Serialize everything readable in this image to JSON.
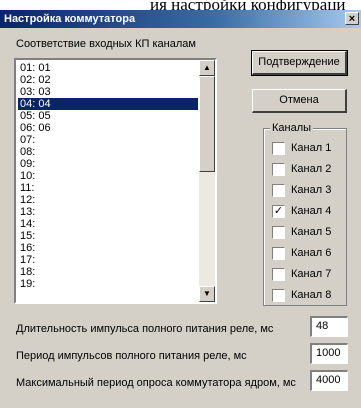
{
  "window": {
    "title": "Настройка коммутатора",
    "close_glyph": "×"
  },
  "list_label": "Соответствие входных КП каналам",
  "list_items": [
    "01: 01",
    "02: 02",
    "03: 03",
    "04: 04",
    "05: 05",
    "06: 06",
    "07:",
    "08:",
    "09:",
    "10:",
    "11:",
    "12:",
    "13:",
    "14:",
    "15:",
    "16:",
    "17:",
    "18:",
    "19:"
  ],
  "selected_item": "04: 04",
  "buttons": {
    "confirm_label": "Подтверждение",
    "cancel_label": "Отмена"
  },
  "channels_group": {
    "label": "Каналы",
    "items": [
      {
        "label": "Канал 1",
        "checked": false
      },
      {
        "label": "Канал 2",
        "checked": false
      },
      {
        "label": "Канал 3",
        "checked": false
      },
      {
        "label": "Канал 4",
        "checked": true
      },
      {
        "label": "Канал 5",
        "checked": false
      },
      {
        "label": "Канал 6",
        "checked": false
      },
      {
        "label": "Канал 7",
        "checked": false
      },
      {
        "label": "Канал 8",
        "checked": false
      }
    ]
  },
  "settings": [
    {
      "label": "Длительность импульса полного питания реле, мс",
      "value": "48"
    },
    {
      "label": "Период импульсов полного питания  реле, мс",
      "value": "1000"
    },
    {
      "label": "Максимальный период опроса коммутатора ядром, мс",
      "value": "4000"
    }
  ],
  "icons": {
    "scroll_up": "up-arrow-icon",
    "scroll_down": "down-arrow-icon",
    "checkmark": "checkmark-icon"
  }
}
